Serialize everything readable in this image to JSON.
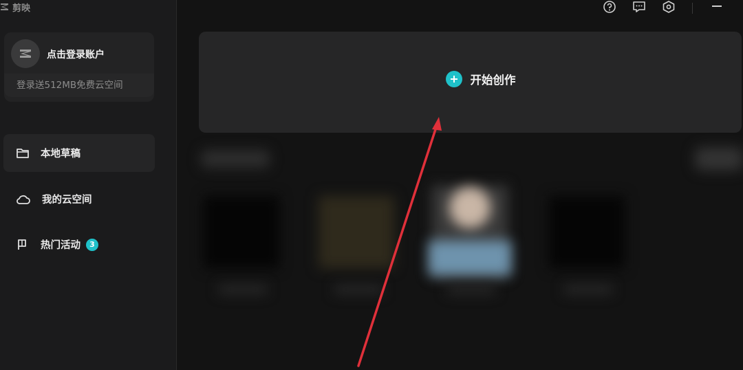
{
  "app": {
    "name": "剪映"
  },
  "account": {
    "login_label": "点击登录账户",
    "promo": "登录送512MB免费云空间"
  },
  "sidebar": {
    "items": [
      {
        "label": "本地草稿",
        "icon": "folder-icon",
        "active": true
      },
      {
        "label": "我的云空间",
        "icon": "cloud-icon",
        "active": false
      },
      {
        "label": "热门活动",
        "icon": "flag-icon",
        "active": false,
        "badge": "3"
      }
    ]
  },
  "topbar": {
    "icons": [
      "help-icon",
      "feedback-icon",
      "settings-icon",
      "minimize-icon"
    ]
  },
  "main": {
    "create_label": "开始创作"
  },
  "colors": {
    "accent": "#1fc1c9",
    "annotation_arrow": "#e0303a",
    "background": "#131313",
    "sidebar": "#1b1b1c",
    "card": "#262627"
  }
}
